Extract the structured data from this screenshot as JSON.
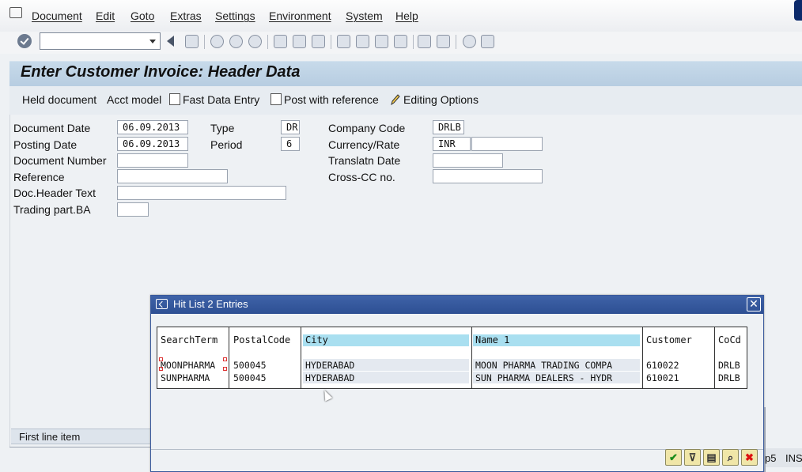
{
  "menubar": {
    "items": [
      "Document",
      "Edit",
      "Goto",
      "Extras",
      "Settings",
      "Environment",
      "System",
      "Help"
    ]
  },
  "toolbar": {
    "command_field_value": "",
    "icons": [
      "enter-icon",
      "back-icon",
      "save-icon",
      "back-arrow-icon",
      "exit-icon",
      "cancel-icon",
      "print-icon",
      "find-icon",
      "find-next-icon",
      "first-page-icon",
      "previous-page-icon",
      "next-page-icon",
      "last-page-icon",
      "create-session-icon",
      "shortcut-icon",
      "help-icon",
      "layout-icon"
    ]
  },
  "title": "Enter Customer Invoice: Header Data",
  "app_toolbar": {
    "held_document": "Held document",
    "acct_model": "Acct model",
    "fast_data_entry": "Fast Data Entry",
    "post_with_reference": "Post with reference",
    "editing_options": "Editing Options"
  },
  "form": {
    "document_date": {
      "label": "Document Date",
      "value": "06.09.2013"
    },
    "posting_date": {
      "label": "Posting Date",
      "value": "06.09.2013"
    },
    "document_number": {
      "label": "Document Number",
      "value": ""
    },
    "reference": {
      "label": "Reference",
      "value": ""
    },
    "doc_header_text": {
      "label": "Doc.Header Text",
      "value": ""
    },
    "trading_part_ba": {
      "label": "Trading part.BA",
      "value": ""
    },
    "type": {
      "label": "Type",
      "value": "DR"
    },
    "period": {
      "label": "Period",
      "value": "6"
    },
    "company_code": {
      "label": "Company Code",
      "value": "DRLB"
    },
    "currency_rate": {
      "label": "Currency/Rate",
      "value": "INR",
      "rate": ""
    },
    "translatn_date": {
      "label": "Translatn Date",
      "value": ""
    },
    "cross_cc_no": {
      "label": "Cross-CC no.",
      "value": ""
    }
  },
  "first_line_item": "First line item",
  "status": {
    "left_fragment": "p5",
    "mode": "INS"
  },
  "dialog": {
    "title": "Hit List 2 Entries",
    "headers": [
      "SearchTerm",
      "PostalCode",
      "City",
      "Name 1",
      "Customer",
      "CoCd"
    ],
    "rows": [
      [
        "MOONPHARMA",
        "500045",
        "HYDERABAD",
        "MOON PHARMA TRADING COMPA",
        "610022",
        "DRLB"
      ],
      [
        "SUNPHARMA",
        "500045",
        "HYDERABAD",
        "SUN PHARMA DEALERS - HYDR",
        "610021",
        "DRLB"
      ]
    ],
    "buttons": [
      "continue-check-icon",
      "filter-icon",
      "sort-icon",
      "find-icon",
      "cancel-x-icon"
    ]
  },
  "colors": {
    "title_band": "#c0d5e8",
    "dialog_titlebar": "#34579c",
    "header_highlight": "#a9dff0",
    "dialog_button": "#f0e6a8"
  }
}
